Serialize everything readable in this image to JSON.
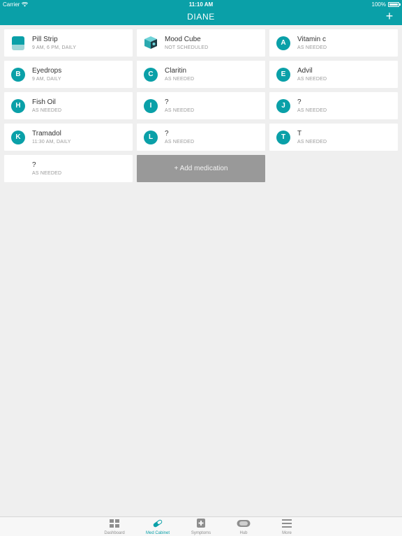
{
  "status_bar": {
    "carrier": "Carrier",
    "time": "11:10 AM",
    "battery": "100%"
  },
  "nav": {
    "title": "DIANE",
    "add_label": "+"
  },
  "medications": [
    {
      "icon": "pill-strip",
      "name": "Pill Strip",
      "schedule": "9 AM, 6 PM, DAILY"
    },
    {
      "icon": "mood-cube",
      "name": "Mood Cube",
      "schedule": "NOT SCHEDULED"
    },
    {
      "letter": "A",
      "name": "Vitamin c",
      "schedule": "AS NEEDED"
    },
    {
      "letter": "B",
      "name": "Eyedrops",
      "schedule": "9 AM, DAILY"
    },
    {
      "letter": "C",
      "name": "Claritin",
      "schedule": "AS NEEDED"
    },
    {
      "letter": "E",
      "name": "Advil",
      "schedule": "AS NEEDED"
    },
    {
      "letter": "H",
      "name": "Fish Oil",
      "schedule": "AS NEEDED"
    },
    {
      "letter": "I",
      "name": "?",
      "schedule": "AS NEEDED"
    },
    {
      "letter": "J",
      "name": "?",
      "schedule": "AS NEEDED"
    },
    {
      "letter": "K",
      "name": "Tramadol",
      "schedule": "11:30 AM, DAILY"
    },
    {
      "letter": "L",
      "name": "?",
      "schedule": "AS NEEDED"
    },
    {
      "letter": "T",
      "name": "T",
      "schedule": "AS NEEDED"
    },
    {
      "name": "?",
      "schedule": "AS NEEDED"
    }
  ],
  "add_medication_label": "+ Add medication",
  "tabs": [
    {
      "label": "Dashboard",
      "icon": "grid-icon"
    },
    {
      "label": "Med Cabinet",
      "icon": "pill-icon"
    },
    {
      "label": "Symptoms",
      "icon": "plus-square-icon"
    },
    {
      "label": "Hub",
      "icon": "hub-icon"
    },
    {
      "label": "More",
      "icon": "menu-icon"
    }
  ],
  "colors": {
    "accent": "#0aa0a8",
    "background": "#efefef",
    "add_button": "#999999"
  }
}
